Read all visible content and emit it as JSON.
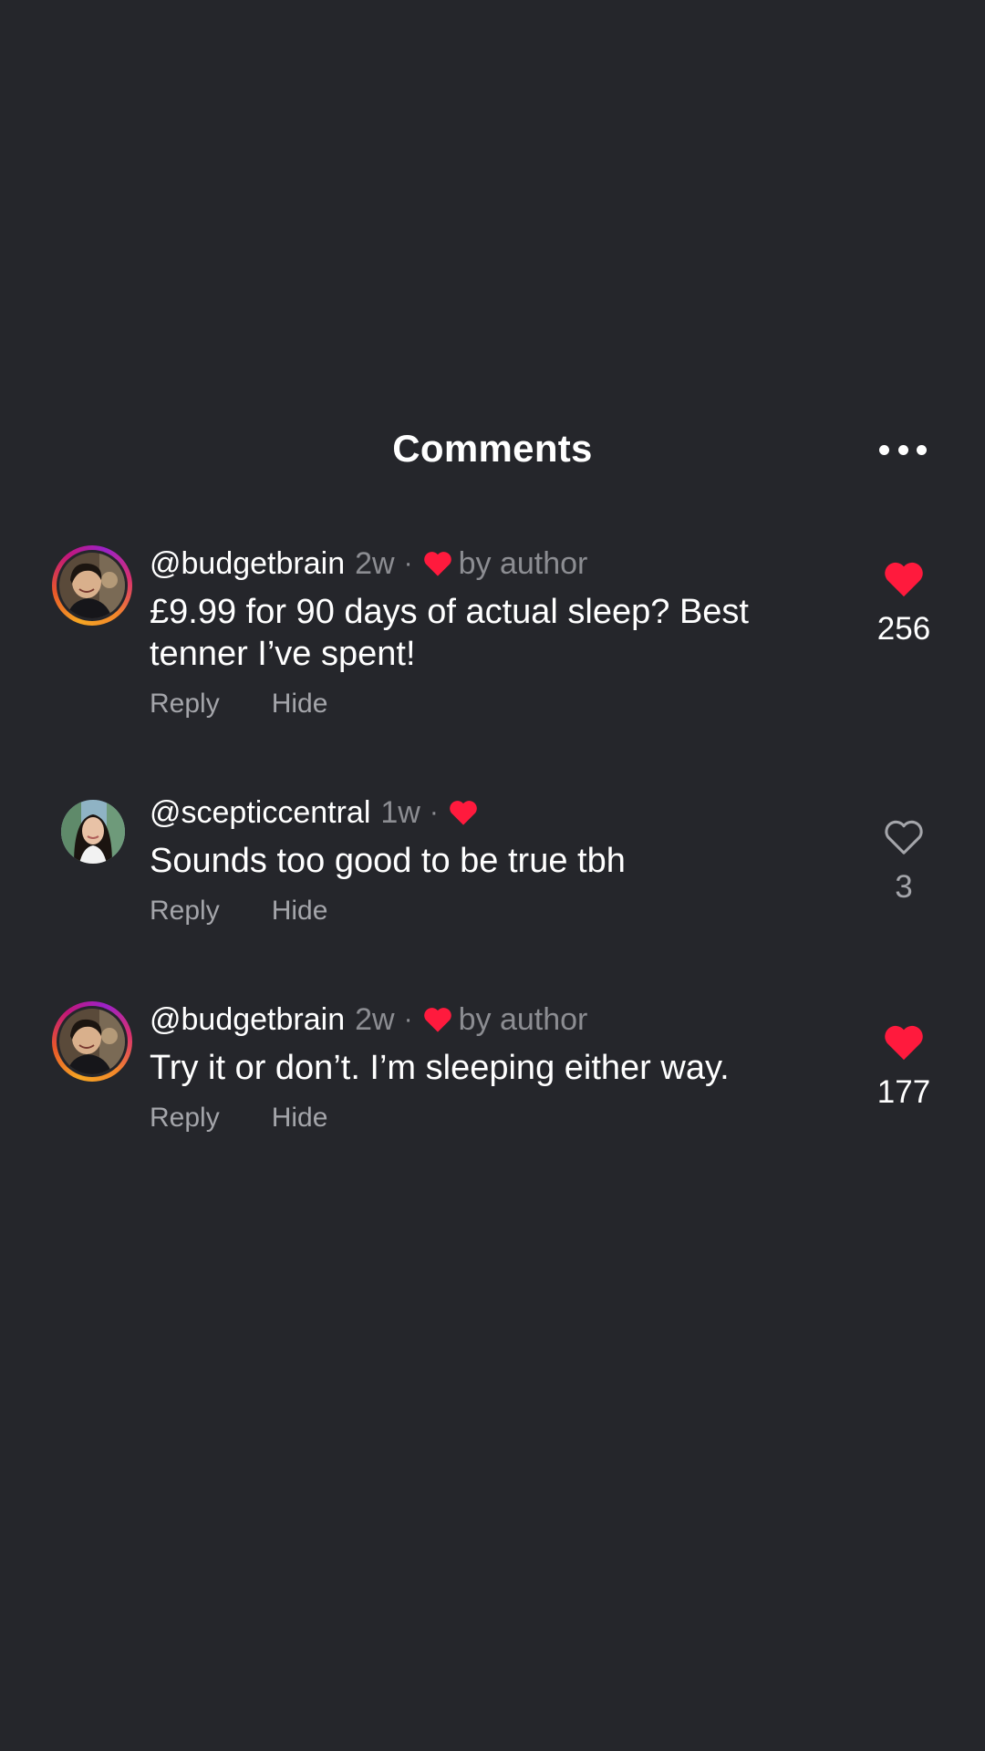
{
  "header": {
    "title": "Comments",
    "more_icon": "more-horizontal-icon"
  },
  "colors": {
    "background": "#25262b",
    "heart_red": "#ff1a3d",
    "muted_text": "#8c8d92"
  },
  "comments": [
    {
      "username": "@budgetbrain",
      "time": "2w",
      "separator": "·",
      "liked_by_author": true,
      "by_author_label": "by author",
      "text": "£9.99 for 90 days of actual sleep? Best tenner I’ve spent!",
      "reply_label": "Reply",
      "hide_label": "Hide",
      "like_count": "256",
      "liked": true,
      "avatar": "avatar-with-story-ring"
    },
    {
      "username": "@scepticcentral",
      "time": "1w",
      "separator": "·",
      "liked_by_author": true,
      "by_author_label": "",
      "text": "Sounds too good to be true tbh",
      "reply_label": "Reply",
      "hide_label": "Hide",
      "like_count": "3",
      "liked": false,
      "avatar": "avatar-plain"
    },
    {
      "username": "@budgetbrain",
      "time": "2w",
      "separator": "·",
      "liked_by_author": true,
      "by_author_label": "by author",
      "text": "Try it or don’t. I’m sleeping either way.",
      "reply_label": "Reply",
      "hide_label": "Hide",
      "like_count": "177",
      "liked": true,
      "avatar": "avatar-with-story-ring"
    }
  ]
}
